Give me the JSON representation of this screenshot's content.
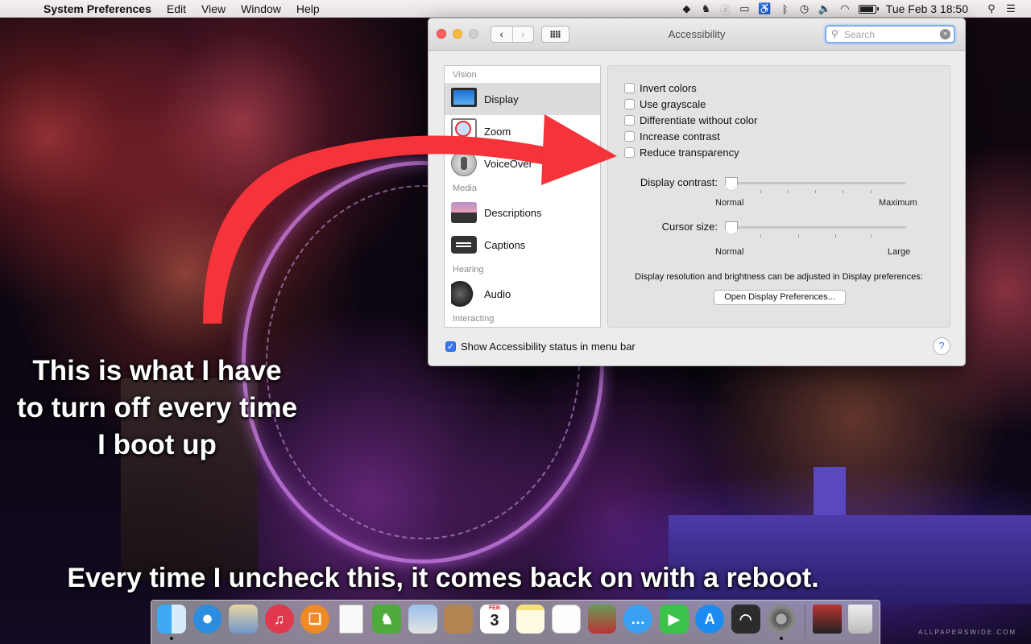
{
  "menubar": {
    "app_name": "System Preferences",
    "menus": [
      "Edit",
      "View",
      "Window",
      "Help"
    ],
    "status_icons": [
      "dropbox-icon",
      "evernote-icon",
      "circle-d-icon",
      "airplay-icon",
      "accessibility-icon",
      "bluetooth-icon",
      "time-machine-icon",
      "volume-icon",
      "wifi-icon",
      "battery-icon",
      "search-icon",
      "list-icon"
    ],
    "battery_level": 0.8,
    "clock": "Tue Feb 3  18:50"
  },
  "window": {
    "title": "Accessibility",
    "search_placeholder": "Search",
    "sidebar": {
      "sections": [
        {
          "label": "Vision",
          "items": [
            {
              "label": "Display",
              "icon": "display-icon",
              "selected": true
            },
            {
              "label": "Zoom",
              "icon": "zoom-icon",
              "selected": false
            },
            {
              "label": "VoiceOver",
              "icon": "voiceover-icon",
              "selected": false
            }
          ]
        },
        {
          "label": "Media",
          "items": [
            {
              "label": "Descriptions",
              "icon": "descriptions-icon",
              "selected": false
            },
            {
              "label": "Captions",
              "icon": "captions-icon",
              "selected": false
            }
          ]
        },
        {
          "label": "Hearing",
          "items": [
            {
              "label": "Audio",
              "icon": "audio-icon",
              "selected": false
            }
          ]
        },
        {
          "label": "Interacting",
          "items": []
        }
      ]
    },
    "display": {
      "checkboxes": [
        {
          "label": "Invert colors",
          "checked": false
        },
        {
          "label": "Use grayscale",
          "checked": false
        },
        {
          "label": "Differentiate without color",
          "checked": false
        },
        {
          "label": "Increase contrast",
          "checked": false
        },
        {
          "label": "Reduce transparency",
          "checked": false
        }
      ],
      "contrast": {
        "label": "Display contrast:",
        "min_label": "Normal",
        "max_label": "Maximum",
        "value": 0
      },
      "cursor": {
        "label": "Cursor size:",
        "min_label": "Normal",
        "max_label": "Large",
        "value": 0
      },
      "info": "Display resolution and brightness can be adjusted in Display preferences:",
      "button": "Open Display Preferences..."
    },
    "status_checkbox": {
      "label": "Show Accessibility status in menu bar",
      "checked": true
    },
    "help": "?"
  },
  "annotations": {
    "caption_top": "This is what I have to turn off every time I boot up",
    "caption_bottom": "Every time I uncheck this, it comes back on with a reboot.",
    "arrow_color": "#f5333a"
  },
  "dock": {
    "apps": [
      "finder-icon",
      "safari-icon",
      "mail-icon",
      "itunes-icon",
      "ibooks-icon",
      "preview-icon",
      "evernote-icon",
      "photos-icon",
      "contacts-icon",
      "calendar-icon",
      "notes-icon",
      "reminders-icon",
      "photo-booth-icon",
      "messages-icon",
      "facetime-icon",
      "app-store-icon",
      "wifi-diag-icon",
      "system-preferences-icon"
    ],
    "calendar_day": "3",
    "calendar_month": "FEB",
    "watermark": "ALLPAPERSWIDE.COM"
  }
}
